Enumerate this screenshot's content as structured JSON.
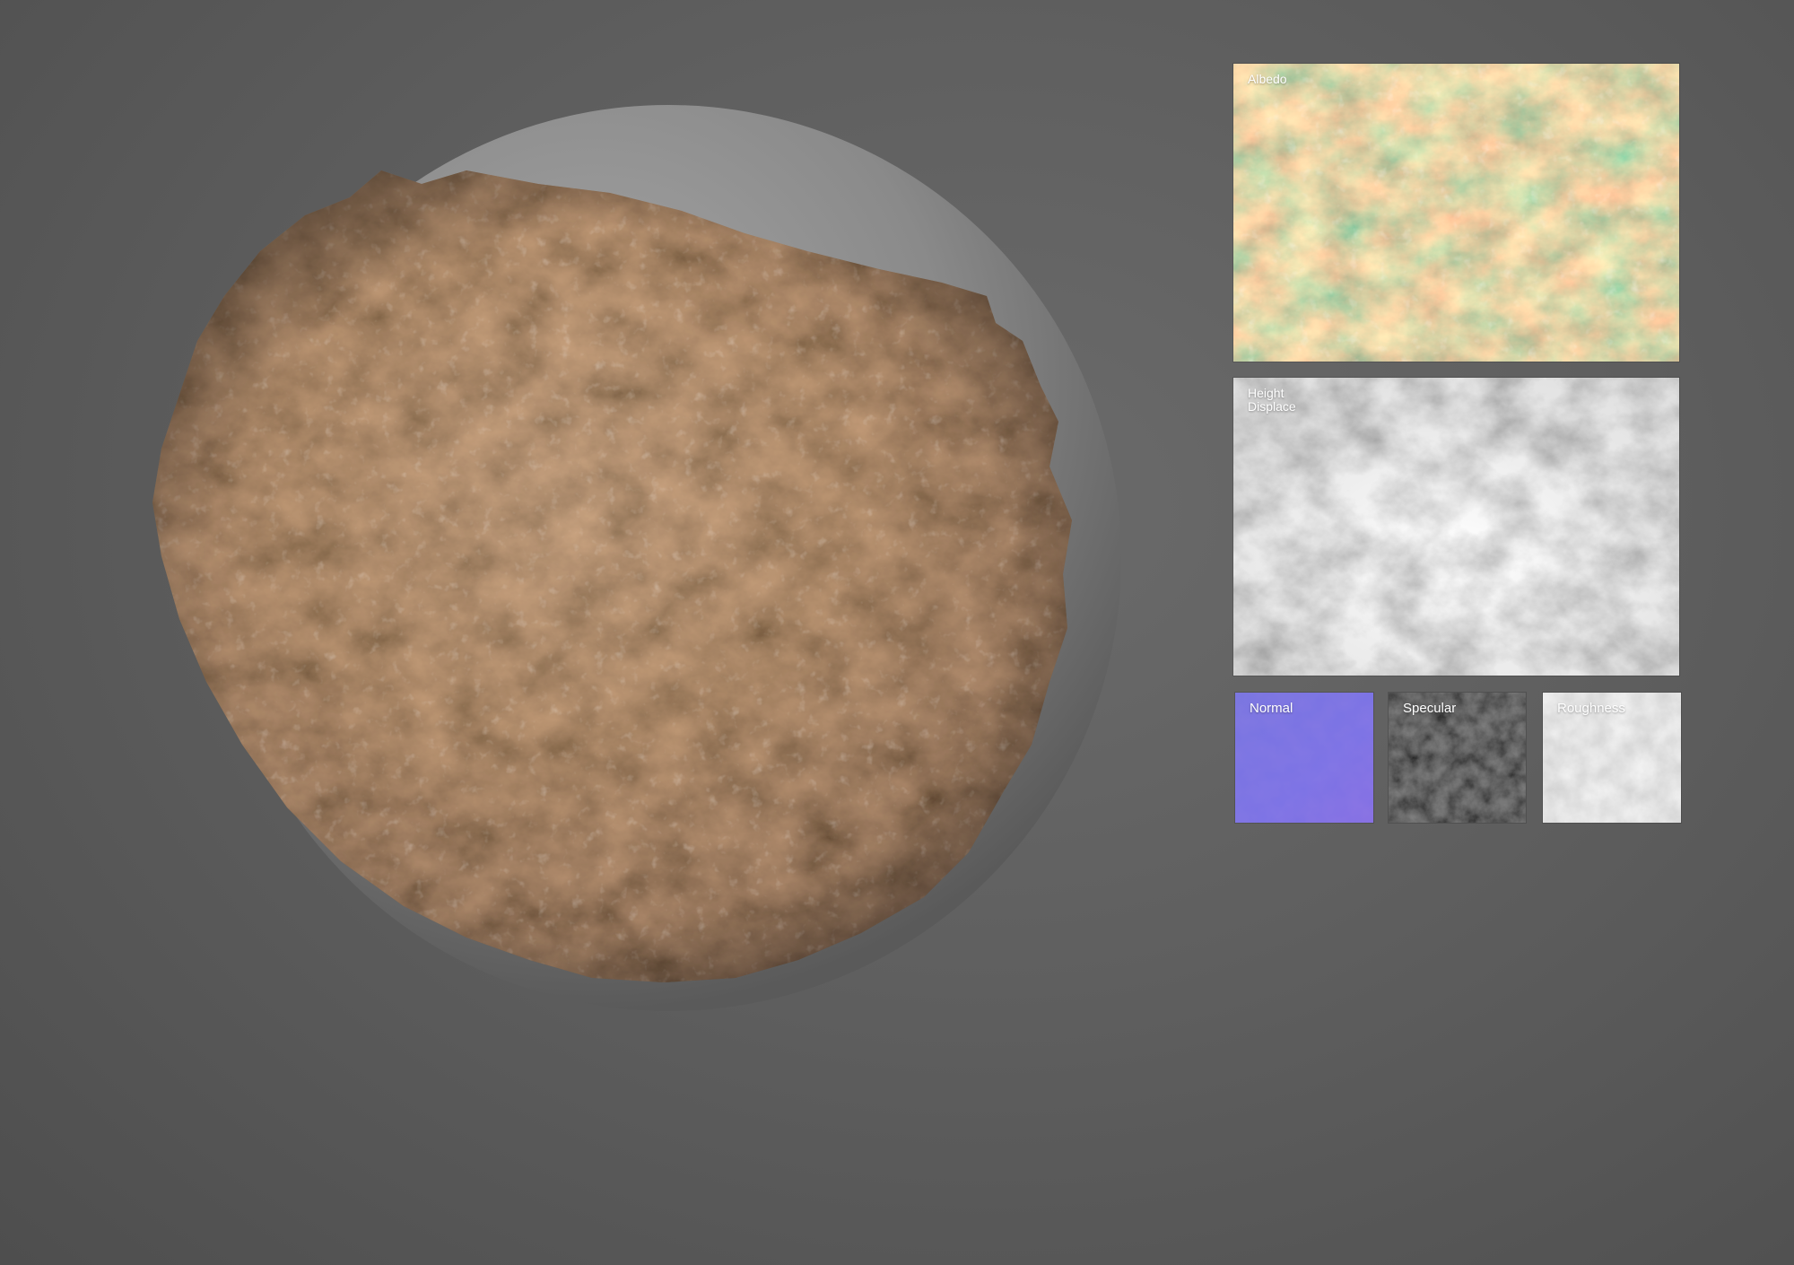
{
  "maps": {
    "albedo": {
      "label": "Albedo"
    },
    "height": {
      "label": "Height \nDisplace"
    },
    "normal": {
      "label": "Normal"
    },
    "specular": {
      "label": "Specular"
    },
    "roughness": {
      "label": "Roughness"
    }
  },
  "colors": {
    "background": "#5f5f5f",
    "sphere": "#8a8a8a",
    "rock_base": "#9a7c5a",
    "rock_red": "#a4522f",
    "normal": "#6f68e0",
    "specular": "#1c1c1c",
    "roughness": "#c9c9c9"
  }
}
